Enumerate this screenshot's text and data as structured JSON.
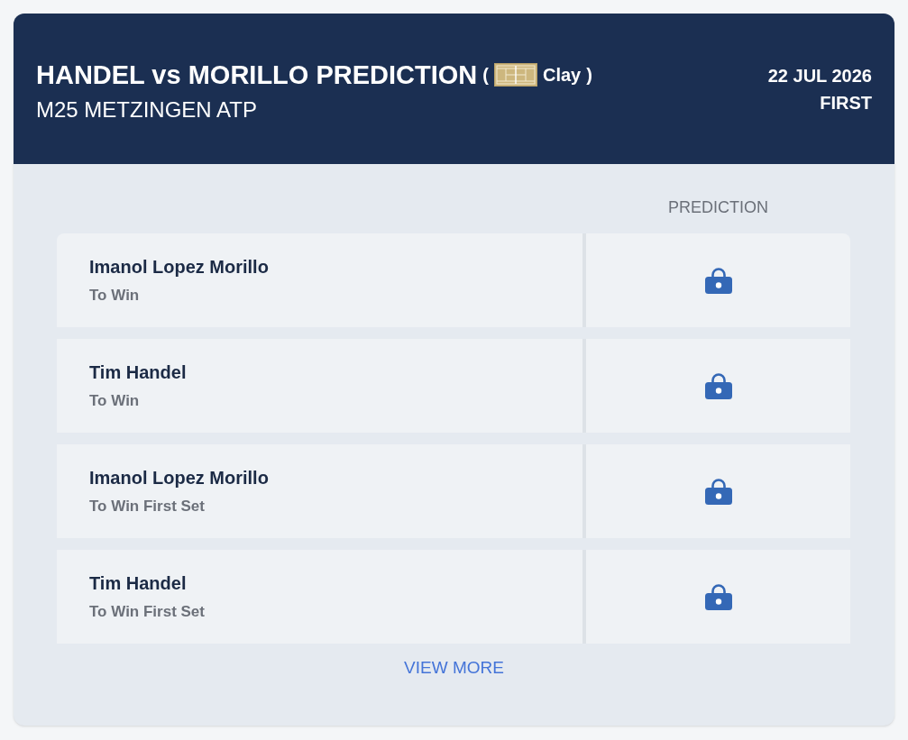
{
  "header": {
    "title": "HANDEL vs MORILLO PREDICTION",
    "surface": {
      "open": "(",
      "label": "Clay",
      "close": ")"
    },
    "tournament": "M25 METZINGEN ATP",
    "date": "22 JUL 2026",
    "round": "FIRST"
  },
  "table": {
    "columns": [
      {
        "label": "PREDICTION"
      }
    ],
    "rows": [
      {
        "player": "Imanol Lopez Morillo",
        "market": "To Win",
        "locked": true
      },
      {
        "player": "Tim Handel",
        "market": "To Win",
        "locked": true
      },
      {
        "player": "Imanol Lopez Morillo",
        "market": "To Win First Set",
        "locked": true
      },
      {
        "player": "Tim Handel",
        "market": "To Win First Set",
        "locked": true
      }
    ]
  },
  "view_more": "VIEW MORE"
}
